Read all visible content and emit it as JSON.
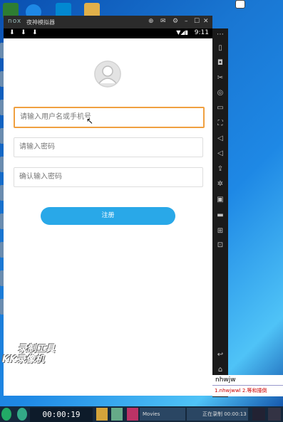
{
  "emulator": {
    "logo": "nox",
    "title": "夜神模拟器",
    "controls": [
      "⊕",
      "✉",
      "⚙",
      "–",
      "☐",
      "✕"
    ]
  },
  "status_bar": {
    "time": "9:11",
    "downloads": [
      "⬇",
      "⬇",
      "⬇"
    ],
    "signal": "▼◢▮"
  },
  "form": {
    "username_placeholder": "请输入用户名或手机号",
    "password_placeholder": "请输入密码",
    "confirm_placeholder": "确认输入密码",
    "register_label": "注册"
  },
  "watermark": {
    "line1": "录制工具",
    "line2": "KK录像机"
  },
  "recording": {
    "elapsed": "00:00:19"
  },
  "taskbar": {
    "item_movies": "Movies",
    "item_recording": "正在录制 00:00:13"
  },
  "ime": {
    "typed": "nhwjw",
    "candidates": "1.nhwjwwl 2.等和撞倒"
  },
  "sidebar_icons": [
    "phone-rotate-icon",
    "screenshot-icon",
    "cut-icon",
    "location-icon",
    "keyboard-icon",
    "fullscreen-icon",
    "volume-up-icon",
    "volume-down-icon",
    "upload-icon",
    "shake-icon",
    "apk-icon",
    "video-icon",
    "multi-instance-icon",
    "more-icon"
  ]
}
